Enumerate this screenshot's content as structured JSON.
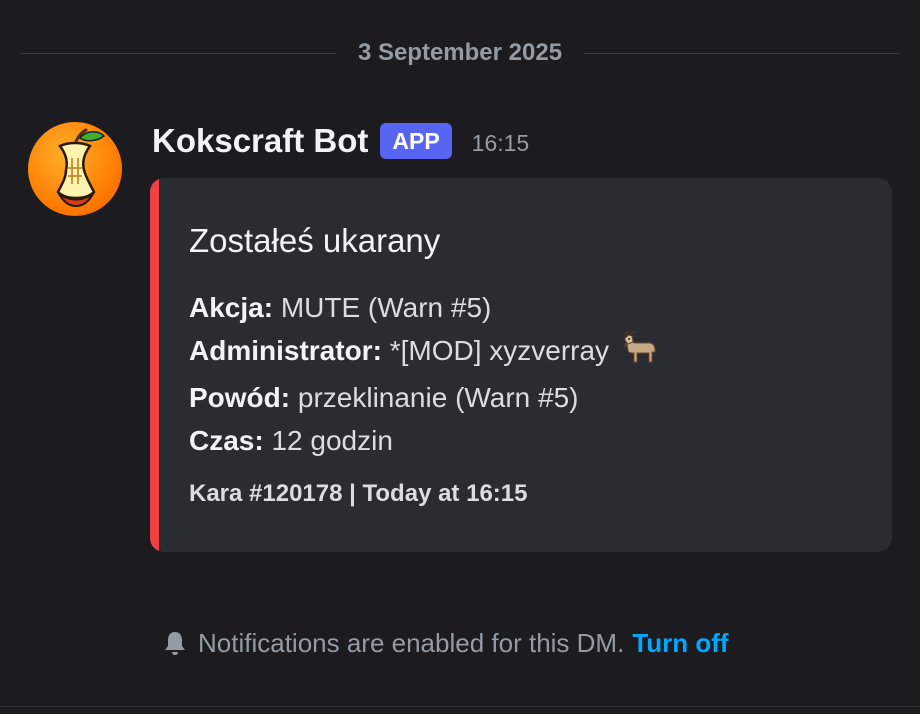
{
  "divider": {
    "date": "3 September 2025"
  },
  "message": {
    "author": "Kokscraft Bot",
    "badge": "APP",
    "time": "16:15",
    "avatar_icon": "apple-core-icon"
  },
  "embed": {
    "accent_color": "#f23f43",
    "title": "Zostałeś ukarany",
    "fields": [
      {
        "label": "Akcja:",
        "value": "MUTE (Warn #5)"
      },
      {
        "label": "Administrator:",
        "value": "*[MOD] xyzverray",
        "emoji": "goat-icon"
      },
      {
        "label": "Powód:",
        "value": "przeklinanie (Warn #5)"
      },
      {
        "label": "Czas:",
        "value": "12 godzin"
      }
    ],
    "footer": "Kara #120178 | Today at 16:15"
  },
  "notice": {
    "icon": "bell-icon",
    "text": "Notifications are enabled for this DM.",
    "link": "Turn off"
  },
  "colors": {
    "background": "#1b1b20",
    "embed_bg": "#2b2c31",
    "badge": "#5865f2",
    "link": "#00a8fc"
  }
}
